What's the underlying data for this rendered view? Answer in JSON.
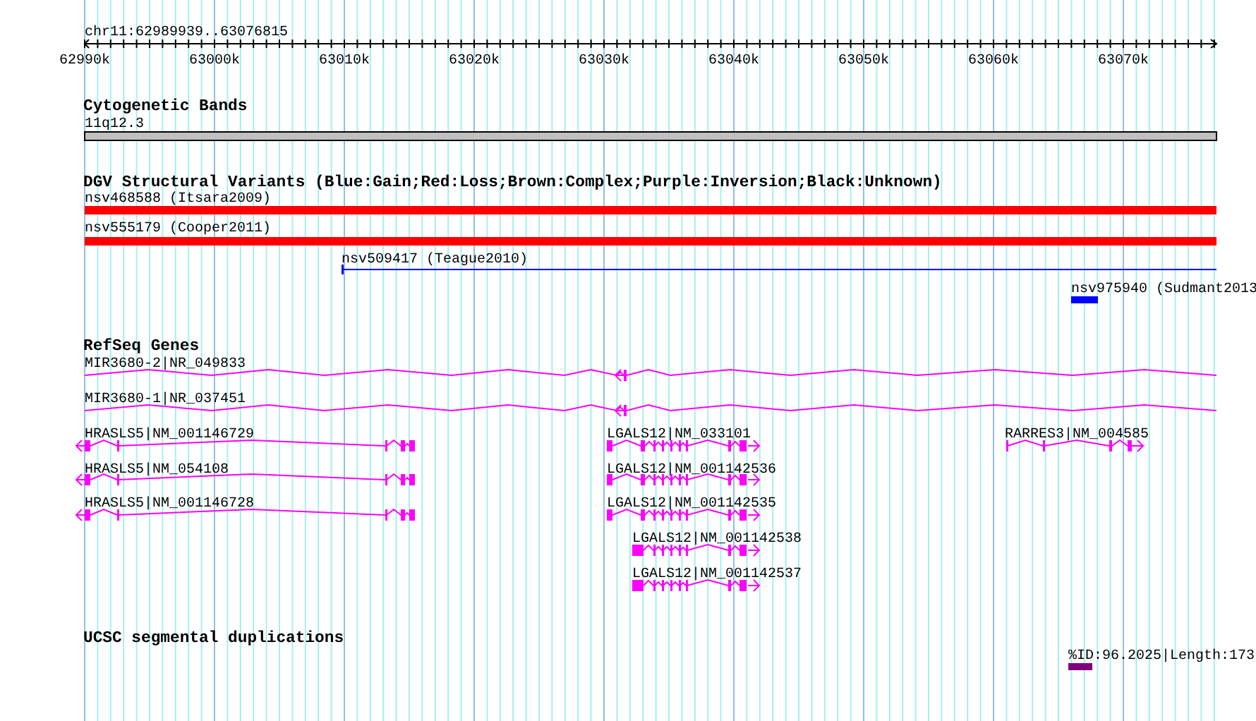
{
  "ruler": {
    "region": "chr11:62989939..63076815",
    "ticks": [
      "62990k",
      "63000k",
      "63010k",
      "63020k",
      "63030k",
      "63040k",
      "63050k",
      "63060k",
      "63070k"
    ]
  },
  "tracks": [
    {
      "title": "Cytogenetic Bands",
      "kind": "cytoband",
      "features": [
        {
          "label": "11q12.3",
          "color": "#c0c0c0"
        }
      ]
    },
    {
      "title": "DGV Structural Variants (Blue:Gain;Red:Loss;Brown:Complex;Purple:Inversion;Black:Unknown)",
      "kind": "variants",
      "features": [
        {
          "label": "nsv468588 (Itsara2009)",
          "color": "#ff0000"
        },
        {
          "label": "nsv555179 (Cooper2011)",
          "color": "#ff0000"
        },
        {
          "label": "nsv509417 (Teague2010)",
          "color": "#0000ff"
        },
        {
          "label": "nsv975940 (Sudmant2013",
          "color": "#0000ff"
        }
      ]
    },
    {
      "title": "RefSeq Genes",
      "kind": "genes",
      "features": [
        {
          "label": "MIR3680-2|NR_049833",
          "reverse_strand": true
        },
        {
          "label": "MIR3680-1|NR_037451",
          "reverse_strand": true
        },
        {
          "label": "HRASLS5|NM_001146729",
          "reverse_strand": true
        },
        {
          "label": "LGALS12|NM_033101",
          "reverse_strand": false
        },
        {
          "label": "RARRES3|NM_004585",
          "reverse_strand": false
        },
        {
          "label": "HRASLS5|NM_054108",
          "reverse_strand": true
        },
        {
          "label": "LGALS12|NM_001142536",
          "reverse_strand": false
        },
        {
          "label": "HRASLS5|NM_001146728",
          "reverse_strand": true
        },
        {
          "label": "LGALS12|NM_001142535",
          "reverse_strand": false
        },
        {
          "label": "LGALS12|NM_001142538",
          "reverse_strand": false
        },
        {
          "label": "LGALS12|NM_001142537",
          "reverse_strand": false
        }
      ]
    },
    {
      "title": "UCSC segmental duplications",
      "kind": "segdups",
      "features": [
        {
          "label": "%ID:96.2025|Length:173",
          "color": "#800080"
        }
      ]
    }
  ]
}
